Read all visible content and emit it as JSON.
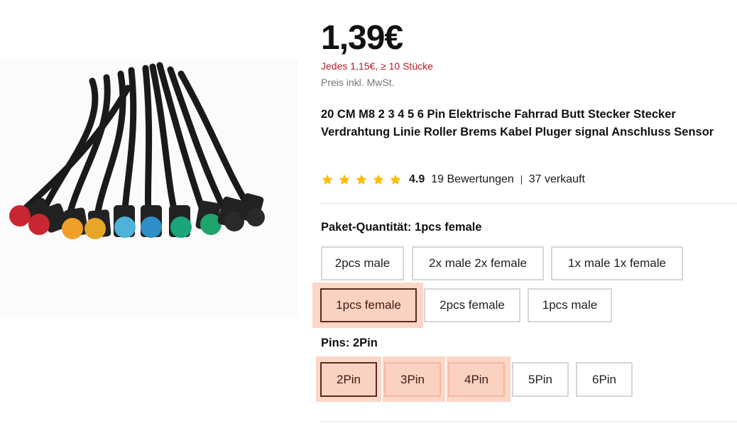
{
  "product": {
    "price": "1,39€",
    "bulk_price": "Jedes 1,15€, ≥ 10 Stücke",
    "vat_note": "Preis inkl. MwSt.",
    "title": "20 CM M8 2 3 4 5 6 Pin Elektrische Fahrrad Butt Stecker Stecker Verdrahtung Linie Roller Brems Kabel Pluger signal Anschluss Sensor",
    "rating": {
      "score": "4.9",
      "stars": 5,
      "reviews": "19 Bewertungen",
      "sold": "37 verkauft"
    },
    "star_color": "#fcbe00"
  },
  "package": {
    "label": "Paket-Quantität:",
    "selected": "1pcs female",
    "options": [
      "2pcs male",
      "2x male 2x female",
      "1x male 1x female",
      "1pcs female",
      "2pcs female",
      "1pcs male"
    ]
  },
  "pins": {
    "label": "Pins:",
    "selected": "2Pin",
    "options": [
      "2Pin",
      "3Pin",
      "4Pin",
      "5Pin",
      "6Pin"
    ]
  },
  "colors": {
    "accent_dark": "#5a2b21",
    "accent_fill": "#fbd1c1",
    "bulk_red": "#b01d27"
  }
}
